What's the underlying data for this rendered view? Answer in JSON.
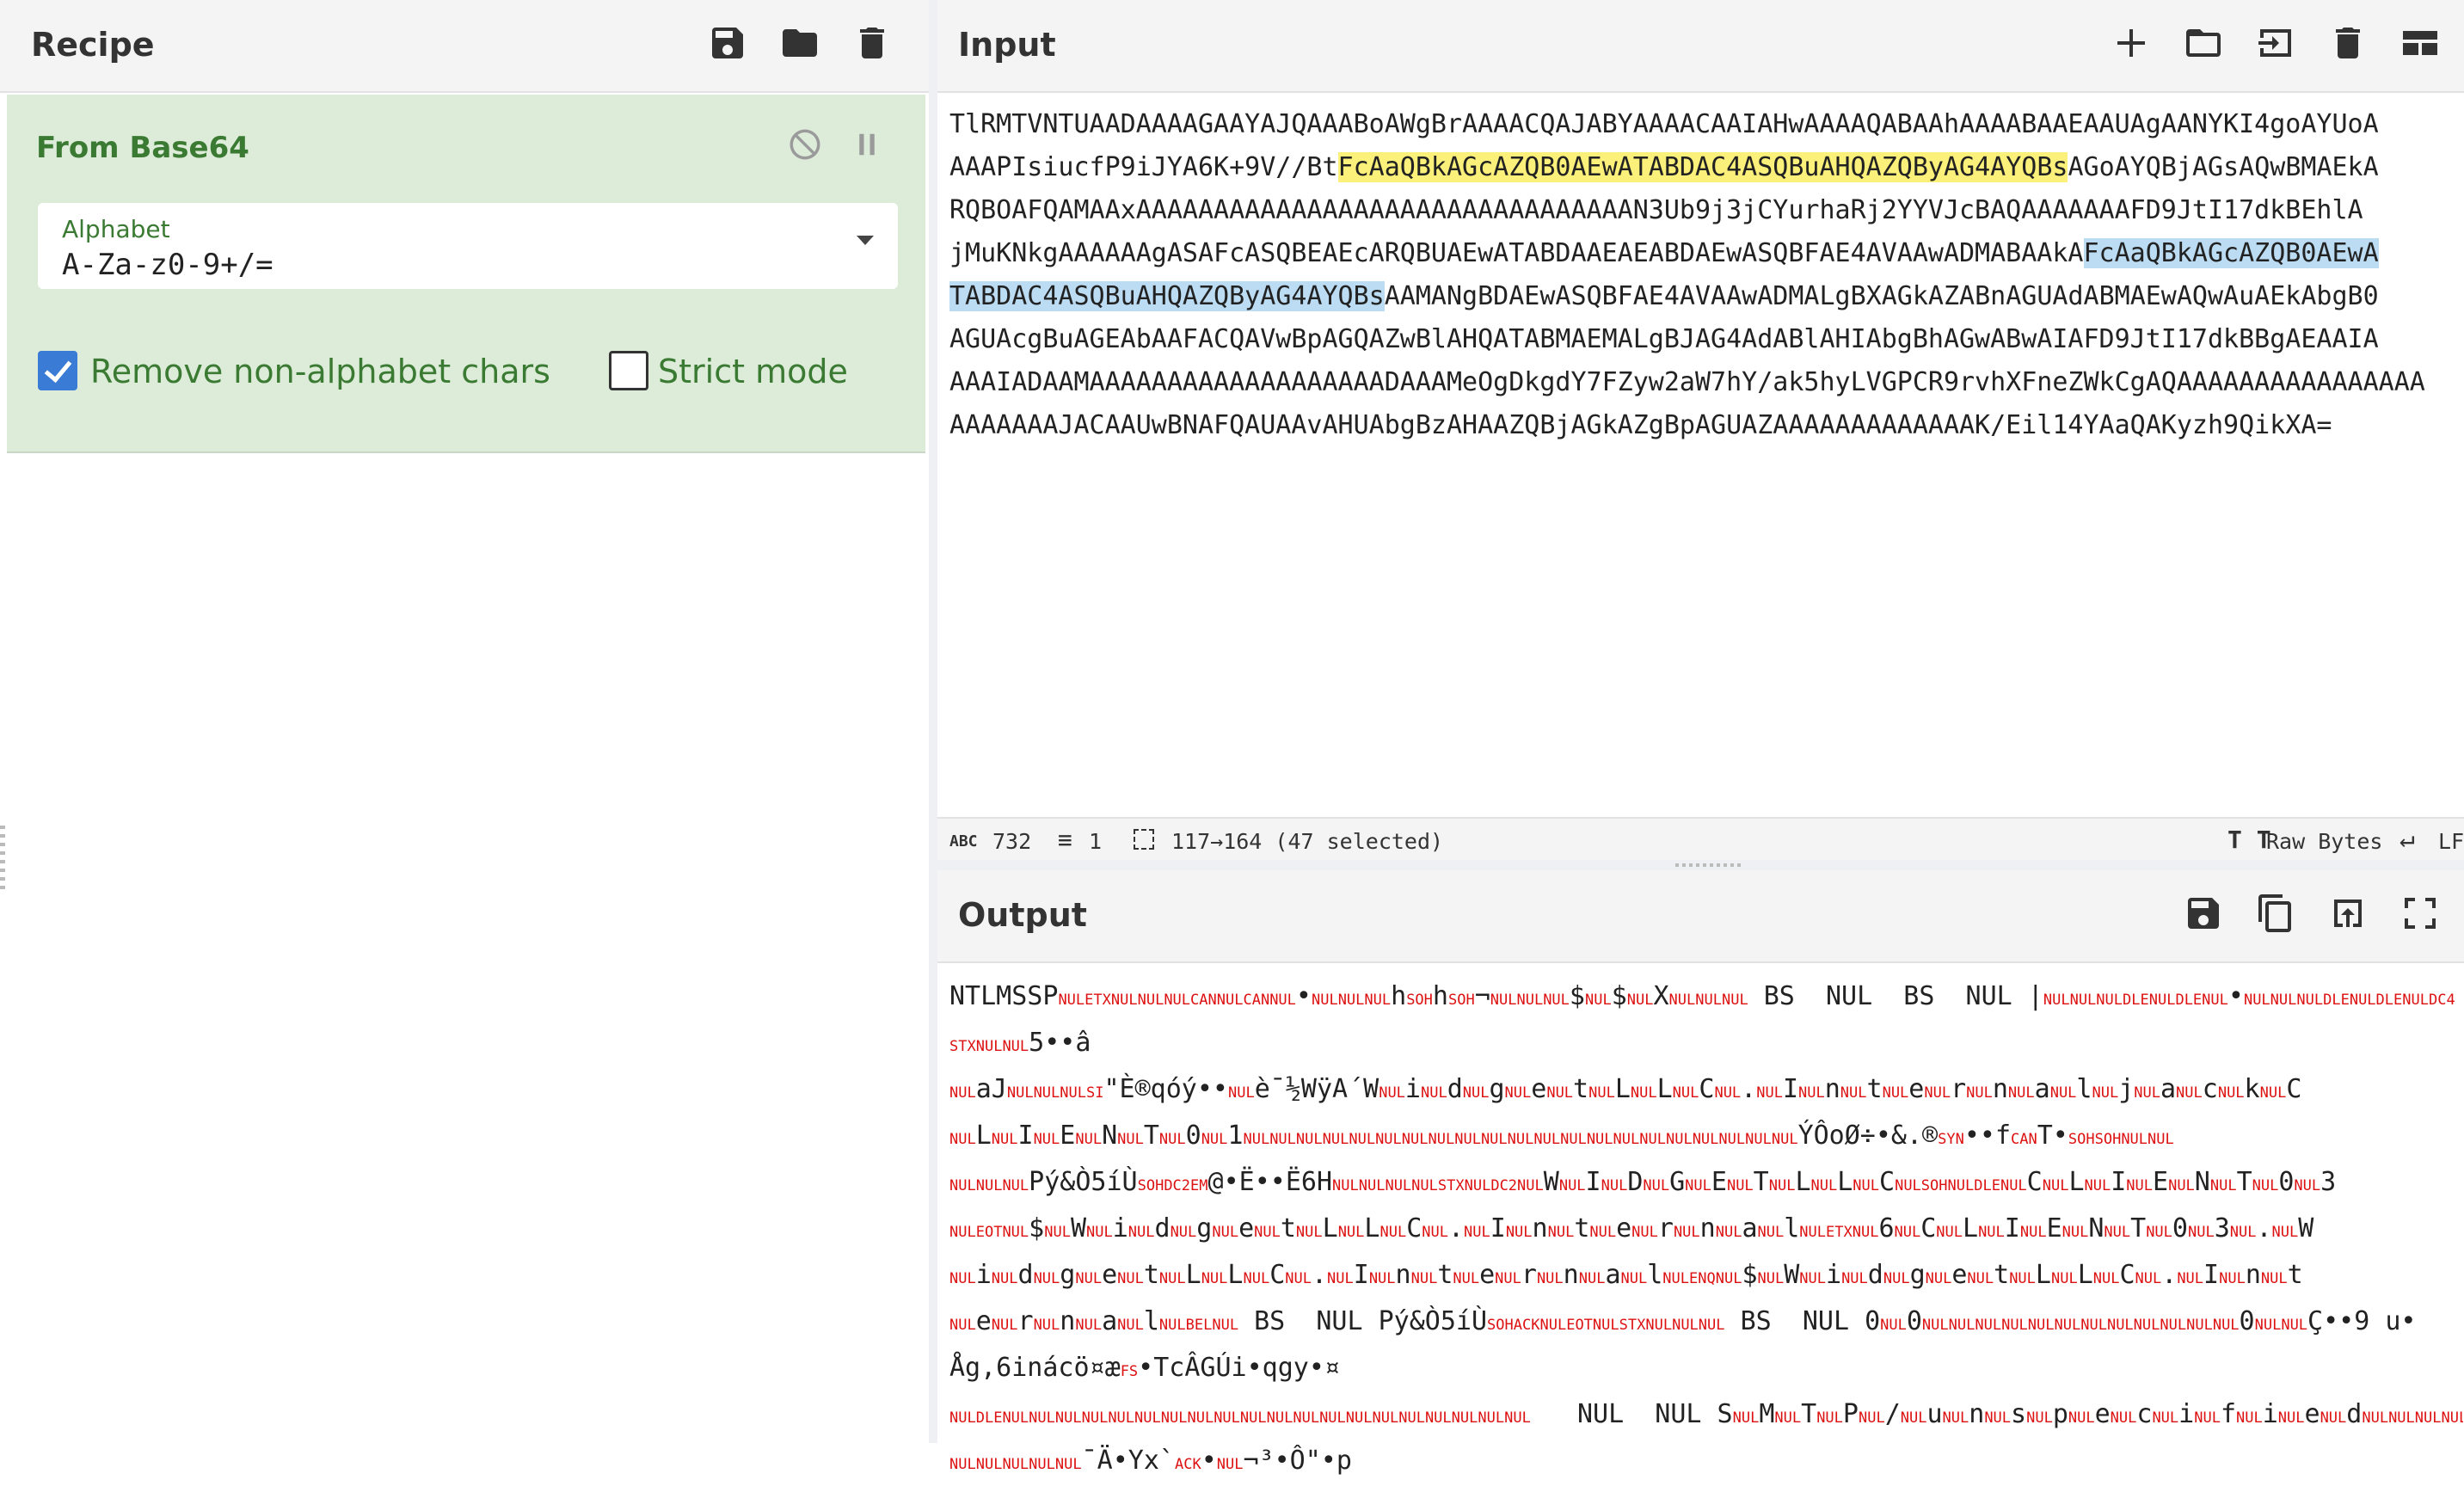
{
  "recipe": {
    "title": "Recipe",
    "icons": [
      "save-icon",
      "folder-icon",
      "trash-icon"
    ],
    "operation": {
      "name": "From Base64",
      "alphabet_label": "Alphabet",
      "alphabet_value": "A-Za-z0-9+/=",
      "remove_non_alphabet_label": "Remove non-alphabet chars",
      "remove_non_alphabet_checked": true,
      "strict_mode_label": "Strict mode",
      "strict_mode_checked": false
    }
  },
  "input": {
    "title": "Input",
    "icons": [
      "plus-icon",
      "folder-icon",
      "input-icon",
      "trash-icon",
      "layout-icon"
    ],
    "lines": [
      [
        {
          "t": "TlRMTVNTUAADAAAAGAAYAJQAAABoAWgBrAAAACQAJABYAAAACAAIAHwAAAAQABAAhAAAABAAEAAUAgAANYKI4goAYUoA"
        }
      ],
      [
        {
          "t": "AAAPIsiucfP9iJYA6K+9V//Bt"
        },
        {
          "t": "FcAaQBkAGcAZQB0AEwATABDAC4ASQBuAHQAZQByAG4AYQBs",
          "h": "y"
        },
        {
          "t": "AGoAYQBjAGsAQwBMAEkA"
        }
      ],
      [
        {
          "t": "RQBOAFQAMAAxAAAAAAAAAAAAAAAAAAAAAAAAAAAAAAAAN3Ub9j3jCYurhaRj2YYVJcBAQAAAAAAAFD9JtI17dkBEhlA"
        }
      ],
      [
        {
          "t": "jMuKNkgAAAAAAgASAFcASQBEAEcARQBUAEwATABDAAEAEABDAEwASQBFAE4AVAAwADMABAAkA"
        },
        {
          "t": "FcAaQBkAGcAZQB0AEwA",
          "h": "b"
        }
      ],
      [
        {
          "t": "TABDAC4ASQBuAHQAZQByAG4AYQBs",
          "h": "b"
        },
        {
          "t": "AAMANgBDAEwASQBFAE4AVAAwADMALgBXAGkAZABnAGUAdABMAEwAQwAuAEkAbgB0"
        }
      ],
      [
        {
          "t": "AGUAcgBuAGEAbAAFACQAVwBpAGQAZwBlAHQATABMAEMALgBJAG4AdABlAHIAbgBhAGwABwAIAFD9JtI17dkBBgAEAAIA"
        }
      ],
      [
        {
          "t": "AAAIADAAMAAAAAAAAAAAAAAAAAAADAAAMeOgDkgdY7FZyw2aW7hY/ak5hyLVGPCR9rvhXFneZWkCgAQAAAAAAAAAAAAAAAA"
        }
      ],
      [
        {
          "t": "AAAAAAAJACAAUwBNAFQAUAAvAHUAbgBzAHAAZQBjAGkAZgBpAGUAZAAAAAAAAAAAAAK/Eil14YAaQAKyzh9QikXA="
        }
      ]
    ],
    "status": {
      "length": "732",
      "lines": "1",
      "selection": "117→164 (47 selected)",
      "encoding": "Raw Bytes",
      "eol": "LF"
    }
  },
  "output": {
    "title": "Output",
    "icons": [
      "save-icon",
      "copy-icon",
      "replace-input-icon",
      "maximize-icon"
    ],
    "lines": [
      "NTLMSSP<NUL><ETX><NUL><NUL><NUL><CAN><NUL><CAN><NUL>•<NUL><NUL><NUL>h<SOH>h<SOH>¬<NUL><NUL><NUL>$<NUL>$<NUL>X<NUL><NUL><NUL> BS  NUL  BS  NUL |<NUL><NUL><NUL><DLE><NUL><DLE><NUL>•<NUL><NUL><NUL><DLE><NUL><DLE><NUL><DC4>",
      "<STX><NUL><NUL>5••â",
      "<NUL>aJ<NUL><NUL><NUL><SI>\"È®qóý••<NUL>è¯½WÿA´W<NUL>i<NUL>d<NUL>g<NUL>e<NUL>t<NUL>L<NUL>L<NUL>C<NUL>.<NUL>I<NUL>n<NUL>t<NUL>e<NUL>r<NUL>n<NUL>a<NUL>l<NUL>j<NUL>a<NUL>c<NUL>k<NUL>C",
      "<NUL>L<NUL>I<NUL>E<NUL>N<NUL>T<NUL>0<NUL>1<NUL><NUL><NUL><NUL><NUL><NUL><NUL><NUL><NUL><NUL><NUL><NUL><NUL><NUL><NUL><NUL><NUL><NUL><NUL><NUL><NUL>ÝÔoØ÷•&.®<SYN>••f<CAN>T•<SOH><SOH><NUL><NUL>",
      "<NUL><NUL><NUL>Pý&Ò5íÙ<SOH><DC2><EM>@•Ë••Ë6H<NUL><NUL><NUL><NUL><STX><NUL><DC2><NUL>W<NUL>I<NUL>D<NUL>G<NUL>E<NUL>T<NUL>L<NUL>L<NUL>C<NUL><SOH><NUL><DLE><NUL>C<NUL>L<NUL>I<NUL>E<NUL>N<NUL>T<NUL>0<NUL>3",
      "<NUL><EOT><NUL>$<NUL>W<NUL>i<NUL>d<NUL>g<NUL>e<NUL>t<NUL>L<NUL>L<NUL>C<NUL>.<NUL>I<NUL>n<NUL>t<NUL>e<NUL>r<NUL>n<NUL>a<NUL>l<NUL><ETX><NUL>6<NUL>C<NUL>L<NUL>I<NUL>E<NUL>N<NUL>T<NUL>0<NUL>3<NUL>.<NUL>W",
      "<NUL>i<NUL>d<NUL>g<NUL>e<NUL>t<NUL>L<NUL>L<NUL>C<NUL>.<NUL>I<NUL>n<NUL>t<NUL>e<NUL>r<NUL>n<NUL>a<NUL>l<NUL><ENQ><NUL>$<NUL>W<NUL>i<NUL>d<NUL>g<NUL>e<NUL>t<NUL>L<NUL>L<NUL>C<NUL>.<NUL>I<NUL>n<NUL>t",
      "<NUL>e<NUL>r<NUL>n<NUL>a<NUL>l<NUL><BEL><NUL> BS  NUL Pý&Ò5íÙ<SOH><ACK><NUL><EOT><NUL><STX><NUL><NUL><NUL> BS  NUL 0<NUL>0<NUL><NUL><NUL><NUL><NUL><NUL><NUL><NUL><NUL><NUL><NUL><NUL>0<NUL><NUL>Ç••9 u•",
      "Åg,6inácö¤æ<FS>•TcÂGÚi•qgy•¤",
      "<NUL><DLE><NUL><NUL><NUL><NUL><NUL><NUL><NUL><NUL><NUL><NUL><NUL><NUL><NUL><NUL><NUL><NUL><NUL><NUL><NUL><NUL>   NUL  NUL S<NUL>M<NUL>T<NUL>P<NUL>/<NUL>u<NUL>n<NUL>s<NUL>p<NUL>e<NUL>c<NUL>i<NUL>f<NUL>i<NUL>e<NUL>d<NUL><NUL><NUL><NUL>",
      "<NUL><NUL><NUL><NUL><NUL>¯Ä•Yx`<ACK>•<NUL>¬³•Ô\"•p"
    ]
  }
}
